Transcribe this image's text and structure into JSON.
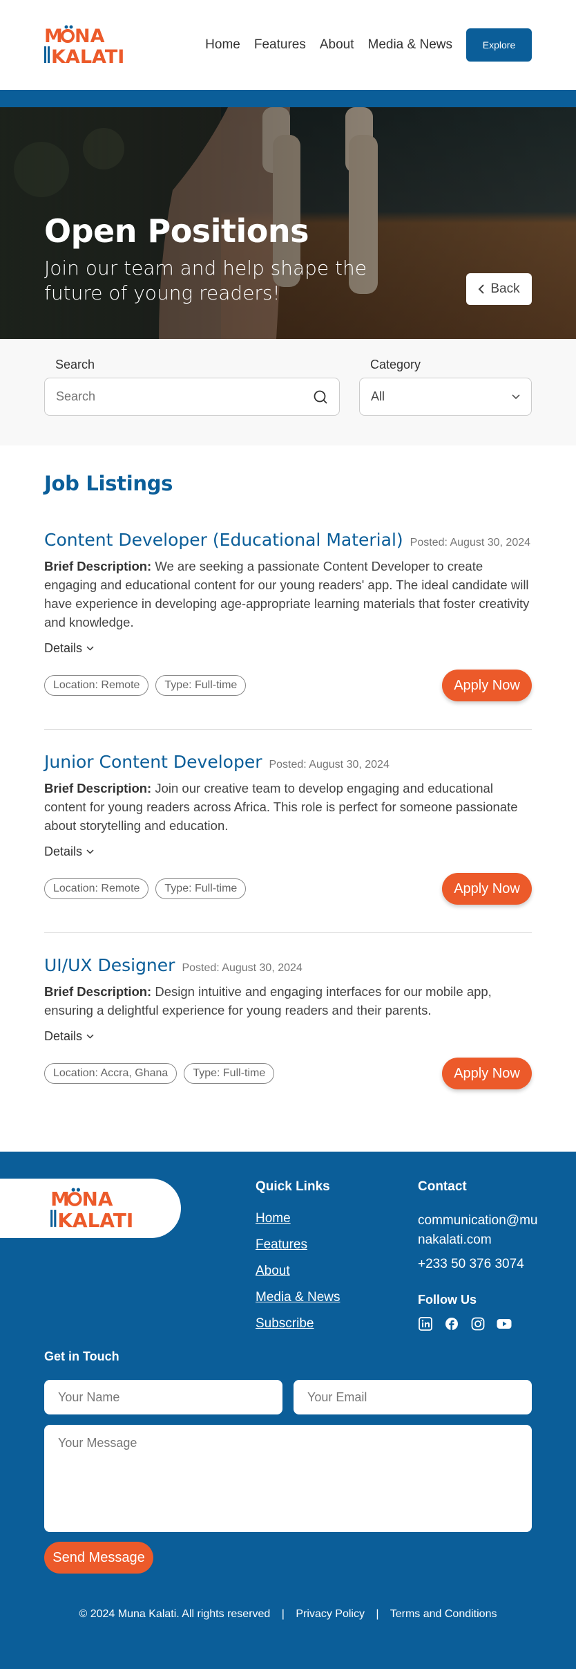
{
  "brand": {
    "line1": "MUNA",
    "line2": "KALATI",
    "orange": "#ec5a2a",
    "blue": "#0b5e99"
  },
  "nav": {
    "items": [
      "Home",
      "Features",
      "About",
      "Media & News"
    ],
    "explore_label": "Explore"
  },
  "hero": {
    "title": "Open Positions",
    "subtitle": "Join our team and help shape the future of young readers!",
    "back_label": "Back"
  },
  "filters": {
    "search_label": "Search",
    "search_placeholder": "Search",
    "category_label": "Category",
    "category_value": "All"
  },
  "jobs": {
    "heading": "Job Listings",
    "desc_prefix": "Brief Description:",
    "details_label": "Details",
    "apply_label": "Apply Now",
    "items": [
      {
        "title": "Content Developer (Educational Material)",
        "posted": "Posted: August 30, 2024",
        "description": "We are seeking a passionate Content Developer to create engaging and educational content for our young readers' app. The ideal candidate will have experience in developing age-appropriate learning materials that foster creativity and knowledge.",
        "location": "Location: Remote",
        "type": "Type: Full-time"
      },
      {
        "title": "Junior Content Developer",
        "posted": "Posted: August 30, 2024",
        "description": "Join our creative team to develop engaging and educational content for young readers across Africa. This role is perfect for someone passionate about storytelling and education.",
        "location": "Location: Remote",
        "type": "Type: Full-time"
      },
      {
        "title": "UI/UX Designer",
        "posted": "Posted: August 30, 2024",
        "description": "Design intuitive and engaging interfaces for our mobile app, ensuring a delightful experience for young readers and their parents.",
        "location": "Location: Accra, Ghana",
        "type": "Type: Full-time"
      }
    ]
  },
  "footer": {
    "quick_links_title": "Quick Links",
    "quick_links": [
      "Home",
      "Features",
      "About",
      "Media & News",
      "Subscribe"
    ],
    "contact_title": "Contact",
    "email": "communication@munakalati.com",
    "phone": "+233 50 376 3074",
    "follow_title": "Follow Us",
    "socials": [
      "linkedin-icon",
      "facebook-icon",
      "instagram-icon",
      "youtube-icon"
    ],
    "get_in_touch": "Get in Touch",
    "name_placeholder": "Your Name",
    "email_placeholder": "Your Email",
    "message_placeholder": "Your Message",
    "send_label": "Send Message",
    "copyright": "© 2024 Muna Kalati. All rights reserved",
    "privacy": "Privacy Policy",
    "terms": "Terms and Conditions"
  }
}
